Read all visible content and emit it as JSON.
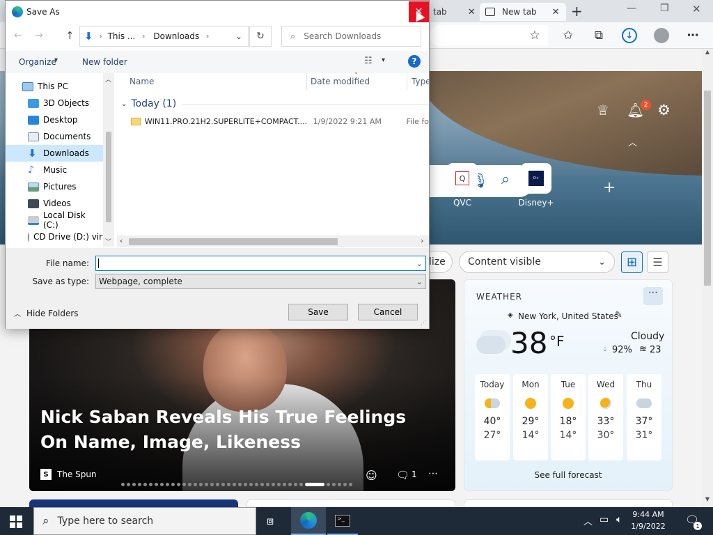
{
  "browser": {
    "tab_partial_label": "tab",
    "tab_label": "New tab",
    "new_tab_symbol": "+",
    "window_controls": {
      "minimize": "—",
      "maximize": "❐",
      "close": "✕"
    }
  },
  "newtab": {
    "notification_count": "2",
    "quicklinks": [
      {
        "label": "QVC"
      },
      {
        "label": "Disney+"
      }
    ],
    "add_symbol": "+",
    "personalize_partial": "lize",
    "content_dropdown": "Content visible",
    "news": {
      "headline": "Nick Saban Reveals His True Feelings On Name, Image, Likeness",
      "source": "The Spun",
      "comment_count": "1"
    },
    "weather": {
      "header": "WEATHER",
      "location": "New York, United States",
      "temperature": "38",
      "unit": "°F",
      "condition": "Cloudy",
      "humidity": "92%",
      "wind": "23",
      "forecast": [
        {
          "day": "Today",
          "high": "40°",
          "low": "27°",
          "icon": "partly-cloudy"
        },
        {
          "day": "Mon",
          "high": "29°",
          "low": "14°",
          "icon": "sunny"
        },
        {
          "day": "Tue",
          "high": "18°",
          "low": "14°",
          "icon": "sunny"
        },
        {
          "day": "Wed",
          "high": "33°",
          "low": "30°",
          "icon": "partly-sunny"
        },
        {
          "day": "Thu",
          "high": "37°",
          "low": "31°",
          "icon": "cloudy"
        }
      ],
      "see_full": "See full forecast"
    }
  },
  "dialog": {
    "title": "Save As",
    "breadcrumb": [
      "This ...",
      "Downloads"
    ],
    "search_placeholder": "Search Downloads",
    "organize": "Organize",
    "new_folder": "New folder",
    "help": "?",
    "tree": [
      {
        "label": "This PC",
        "icon": "pc-icon"
      },
      {
        "label": "3D Objects",
        "icon": "cube-icon"
      },
      {
        "label": "Desktop",
        "icon": "desktop-icon"
      },
      {
        "label": "Documents",
        "icon": "document-icon"
      },
      {
        "label": "Downloads",
        "icon": "download-icon",
        "selected": true
      },
      {
        "label": "Music",
        "icon": "music-icon"
      },
      {
        "label": "Pictures",
        "icon": "pictures-icon"
      },
      {
        "label": "Videos",
        "icon": "videos-icon"
      },
      {
        "label": "Local Disk (C:)",
        "icon": "disk-icon"
      },
      {
        "label": "CD Drive (D:) virt",
        "icon": "cd-icon"
      }
    ],
    "columns": {
      "name": "Name",
      "date": "Date modified",
      "type": "Type"
    },
    "group": "Today (1)",
    "files": [
      {
        "name": "WIN11.PRO.21H2.SUPERLITE+COMPACT....",
        "date": "1/9/2022 9:21 AM",
        "type": "File fo"
      }
    ],
    "filename_label": "File name:",
    "filename_value": "",
    "savetype_label": "Save as type:",
    "savetype_value": "Webpage, complete",
    "hide_folders": "Hide Folders",
    "save": "Save",
    "cancel": "Cancel"
  },
  "taskbar": {
    "search_placeholder": "Type here to search",
    "time": "9:44 AM",
    "date": "1/9/2022",
    "notification_count": "1"
  }
}
